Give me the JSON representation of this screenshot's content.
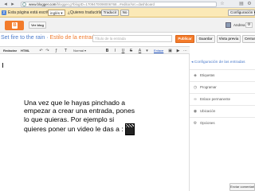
{
  "browser": {
    "url_host": "www.blogger.com",
    "url_rest": "/blogger.g?blogID=1709470098006768...#editor/src=dashboard"
  },
  "translate_bar": {
    "prefix": "Esta página está escrita en",
    "language": "inglés ▾",
    "question": "¿Quieres traducirla?",
    "translate_label": "Traducir",
    "no_label": "No",
    "settings_label": "Configuración ▾"
  },
  "blogger_header": {
    "view_blog_label": "Ver blog",
    "user_name": "Andrea ▾"
  },
  "title_row": {
    "blog_name": "Set fire to the rain",
    "separator": " · ",
    "section": "Estilo de la entrada",
    "title_placeholder": "Título de la entrada",
    "publish_label": "Publicar",
    "save_label": "Guardar",
    "preview_label": "Vista previa",
    "close_label": "Cerrar"
  },
  "toolbar": {
    "compose_label": "Redactar",
    "html_label": "HTML",
    "font_label": "Normal ▾",
    "link_label": "Enlace"
  },
  "post": {
    "lines": [
      "Una vez que le hayas pinchado a",
      "empezar a crear una entrada, pones",
      "lo que quieras. Por ejemplo si",
      "quieres poner un video le das a :"
    ]
  },
  "sidebar": {
    "header": "◂ Configuración de las entradas",
    "items": [
      {
        "label": "Etiquetas",
        "icon": "tag-icon"
      },
      {
        "label": "Programar",
        "icon": "clock-icon"
      },
      {
        "label": "Enlace permanente",
        "icon": "link-icon"
      },
      {
        "label": "Ubicación",
        "icon": "location-icon"
      },
      {
        "label": "Opciones",
        "icon": "options-gear-icon"
      }
    ]
  },
  "comments_button": "Enviar comentarios",
  "colors": {
    "accent_orange": "#f47b2a",
    "link_blue": "#4d7ccb",
    "translate_bar_bg": "#fbe9b7"
  }
}
